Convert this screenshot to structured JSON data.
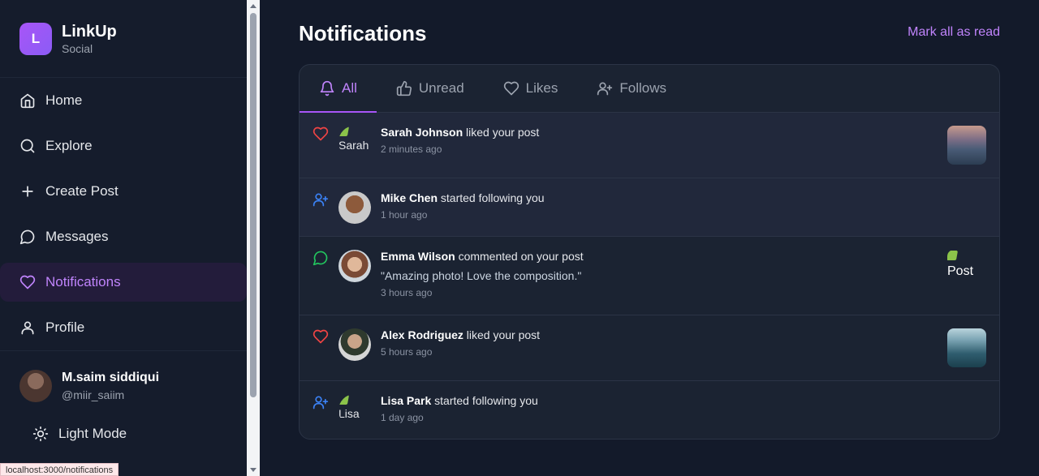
{
  "brand": {
    "logo_letter": "L",
    "name": "LinkUp",
    "subtitle": "Social"
  },
  "nav": {
    "items": [
      {
        "label": "Home",
        "icon": "home-icon"
      },
      {
        "label": "Explore",
        "icon": "search-icon"
      },
      {
        "label": "Create Post",
        "icon": "plus-icon"
      },
      {
        "label": "Messages",
        "icon": "message-icon"
      },
      {
        "label": "Notifications",
        "icon": "heart-icon",
        "active": true
      },
      {
        "label": "Profile",
        "icon": "user-icon"
      }
    ]
  },
  "user": {
    "name": "M.saim siddiqui",
    "handle": "@miir_saiim"
  },
  "mode_toggle": {
    "label": "Light Mode",
    "icon": "sun-icon"
  },
  "status_bar": {
    "url": "localhost:3000/notifications"
  },
  "header": {
    "title": "Notifications",
    "mark_all_label": "Mark all as read"
  },
  "tabs": [
    {
      "label": "All",
      "icon": "bell-icon",
      "active": true
    },
    {
      "label": "Unread",
      "icon": "thumbs-up-icon"
    },
    {
      "label": "Likes",
      "icon": "heart-icon"
    },
    {
      "label": "Follows",
      "icon": "user-plus-icon"
    }
  ],
  "notifications": [
    {
      "type": "like",
      "name": "Sarah Johnson",
      "action": "liked your post",
      "time": "2 minutes ago",
      "avatar_alt": "Sarah",
      "unread": true,
      "thumb": "image"
    },
    {
      "type": "follow",
      "name": "Mike Chen",
      "action": "started following you",
      "time": "1 hour ago",
      "unread": true
    },
    {
      "type": "comment",
      "name": "Emma Wilson",
      "action": "commented on your post",
      "quote": "\"Amazing photo! Love the composition.\"",
      "time": "3 hours ago",
      "thumb_alt": "Post"
    },
    {
      "type": "like",
      "name": "Alex Rodriguez",
      "action": "liked your post",
      "time": "5 hours ago",
      "thumb": "image"
    },
    {
      "type": "follow",
      "name": "Lisa Park",
      "action": "started following you",
      "time": "1 day ago",
      "avatar_alt": "Lisa"
    }
  ],
  "colors": {
    "accent": "#c084fc",
    "like": "#ef4444",
    "follow": "#3b82f6",
    "comment": "#22c55e"
  }
}
